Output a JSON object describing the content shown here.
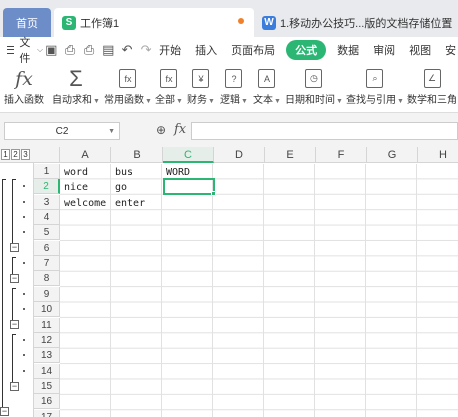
{
  "tabs": {
    "home": "首页",
    "active": "工作簿1",
    "active_icon": "S",
    "inactive": "1.移动办公技巧...版的文档存储位置",
    "inactive_icon": "W"
  },
  "menu": {
    "file": "文件",
    "items": [
      "开始",
      "插入",
      "页面布局",
      "公式",
      "数据",
      "审阅",
      "视图",
      "安"
    ],
    "active_item": "公式"
  },
  "ribbon": {
    "buttons": [
      {
        "icon": "fx-icon",
        "label": "插入函数"
      },
      {
        "icon": "sigma-icon",
        "label": "自动求和"
      },
      {
        "icon": "common-functions-icon",
        "label": "常用函数"
      },
      {
        "icon": "all-functions-icon",
        "label": "全部"
      },
      {
        "icon": "finance-icon",
        "label": "财务"
      },
      {
        "icon": "logic-icon",
        "label": "逻辑"
      },
      {
        "icon": "text-icon",
        "label": "文本"
      },
      {
        "icon": "datetime-icon",
        "label": "日期和时间"
      },
      {
        "icon": "lookup-icon",
        "label": "查找与引用"
      },
      {
        "icon": "math-icon",
        "label": "数学和三角"
      }
    ]
  },
  "formula_bar": {
    "name_box": "C2",
    "fx": "fx",
    "value": ""
  },
  "outline_levels": [
    "1",
    "2",
    "3"
  ],
  "columns": [
    "A",
    "B",
    "C",
    "D",
    "E",
    "F",
    "G",
    "H"
  ],
  "rows": [
    "1",
    "2",
    "3",
    "4",
    "5",
    "6",
    "7",
    "8",
    "9",
    "10",
    "11",
    "12",
    "13",
    "14",
    "15",
    "16",
    "17"
  ],
  "cells": {
    "A1": "word",
    "B1": "bus",
    "C1": "WORD",
    "A2": "nice",
    "B2": "go",
    "A3": "welcome",
    "B3": "enter"
  },
  "selected_cell": "C2",
  "colors": {
    "accent": "#2bb673",
    "home_tab": "#6d8dc9"
  }
}
